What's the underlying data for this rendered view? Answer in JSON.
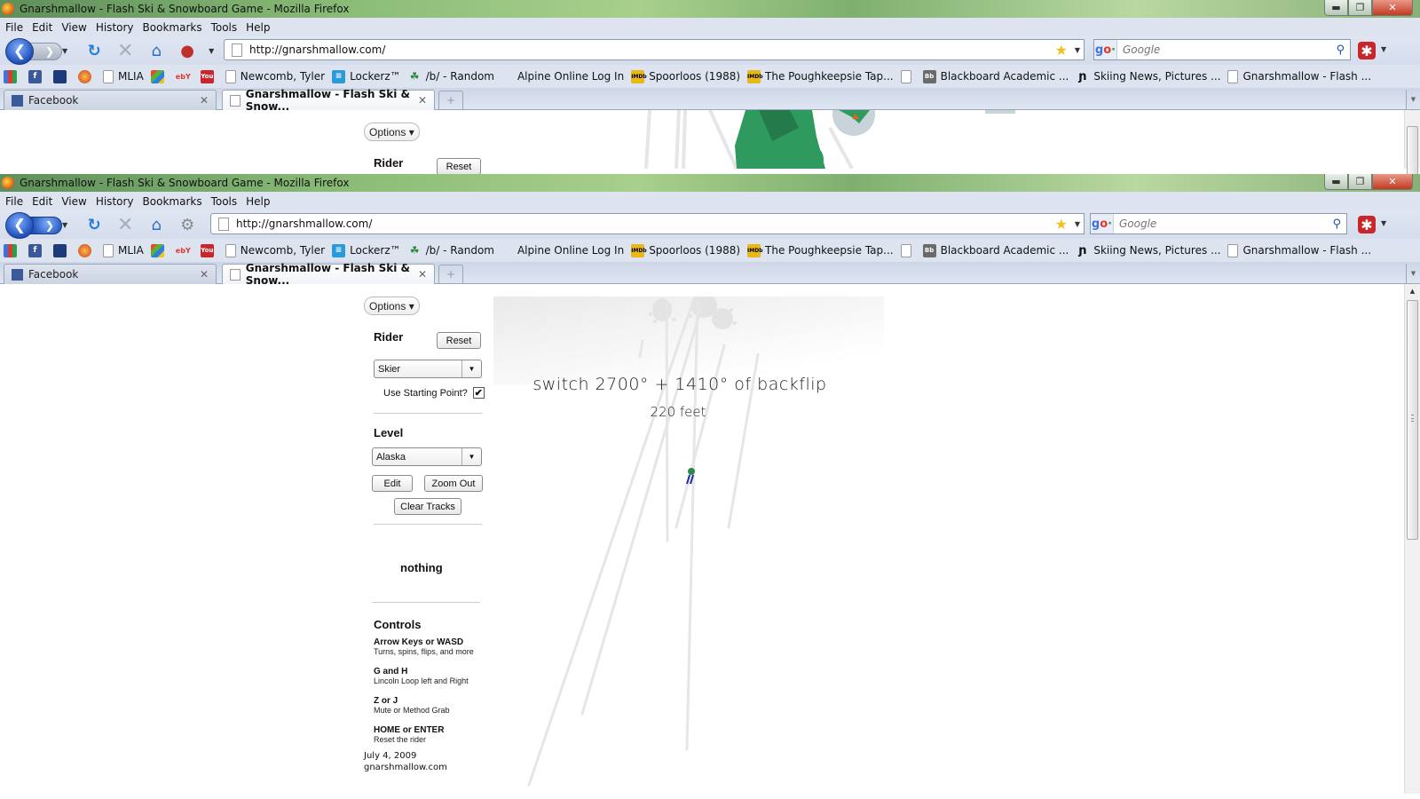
{
  "windows": [
    {
      "title": "Gnarshmallow - Flash Ski & Snowboard Game - Mozilla Firefox",
      "menu": [
        "File",
        "Edit",
        "View",
        "History",
        "Bookmarks",
        "Tools",
        "Help"
      ],
      "url": "http://gnarshmallow.com/",
      "search_placeholder": "Google",
      "bookmarks": [
        {
          "label": "",
          "icon": "google-icon"
        },
        {
          "label": "",
          "icon": "facebook-icon"
        },
        {
          "label": "",
          "icon": "myspace-icon"
        },
        {
          "label": "",
          "icon": "firefox-addon-icon"
        },
        {
          "label": "MLIA",
          "icon": "page-icon"
        },
        {
          "label": "",
          "icon": "windows-icon"
        },
        {
          "label": "",
          "icon": "ebay-icon"
        },
        {
          "label": "",
          "icon": "youtube-icon"
        },
        {
          "label": "Newcomb, Tyler",
          "icon": "page-icon"
        },
        {
          "label": "Lockerz™",
          "icon": "lockerz-icon"
        },
        {
          "label": "/b/ - Random",
          "icon": "clover-icon"
        },
        {
          "label": "Alpine Online Log In",
          "icon": ""
        },
        {
          "label": "Spoorloos (1988)",
          "icon": "imdb-icon"
        },
        {
          "label": "The Poughkeepsie Tap...",
          "icon": "imdb-icon"
        },
        {
          "label": "",
          "icon": "page-icon"
        },
        {
          "label": "Blackboard Academic ...",
          "icon": "blackboard-icon"
        },
        {
          "label": "Skiing News, Pictures ...",
          "icon": "newschoolers-icon"
        },
        {
          "label": "Gnarshmallow - Flash ...",
          "icon": "page-icon"
        }
      ],
      "tabs": [
        {
          "label": "Facebook",
          "active": false
        },
        {
          "label": "Gnarshmallow - Flash Ski & Snow...",
          "active": true
        }
      ],
      "sidebar": {
        "options_label": "Options ▾",
        "rider_title": "Rider",
        "reset_label": "Reset"
      }
    },
    {
      "title": "Gnarshmallow - Flash Ski & Snowboard Game - Mozilla Firefox",
      "menu": [
        "File",
        "Edit",
        "View",
        "History",
        "Bookmarks",
        "Tools",
        "Help"
      ],
      "url": "http://gnarshmallow.com/",
      "search_placeholder": "Google",
      "tabs": [
        {
          "label": "Facebook",
          "active": false
        },
        {
          "label": "Gnarshmallow - Flash Ski & Snow...",
          "active": true
        }
      ],
      "sidebar": {
        "options_label": "Options ▾",
        "rider_title": "Rider",
        "reset_label": "Reset",
        "rider_select": "Skier",
        "starting_point_label": "Use Starting Point?",
        "starting_point_checked": true,
        "level_title": "Level",
        "level_select": "Alaska",
        "edit_label": "Edit",
        "zoom_out_label": "Zoom Out",
        "clear_tracks_label": "Clear Tracks",
        "status_text": "nothing",
        "controls_title": "Controls",
        "controls": [
          {
            "key": "Arrow Keys or WASD",
            "desc": "Turns, spins, flips, and more"
          },
          {
            "key": "G and H",
            "desc": "Lincoln Loop left and Right"
          },
          {
            "key": "Z or J",
            "desc": "Mute or Method Grab"
          },
          {
            "key": "HOME or ENTER",
            "desc": "Reset the rider"
          }
        ],
        "footer_date": "July 4, 2009",
        "footer_site": "gnarshmallow.com"
      },
      "game": {
        "trick_text": "switch 2700° + 1410° of backflip",
        "distance_text": "220 feet"
      }
    }
  ],
  "colors": {
    "accent_blue": "#1e4fb8",
    "tree_green": "#2f9a5e",
    "track_gray": "#e6e6e6",
    "rider_blue": "#1a2aa8"
  }
}
